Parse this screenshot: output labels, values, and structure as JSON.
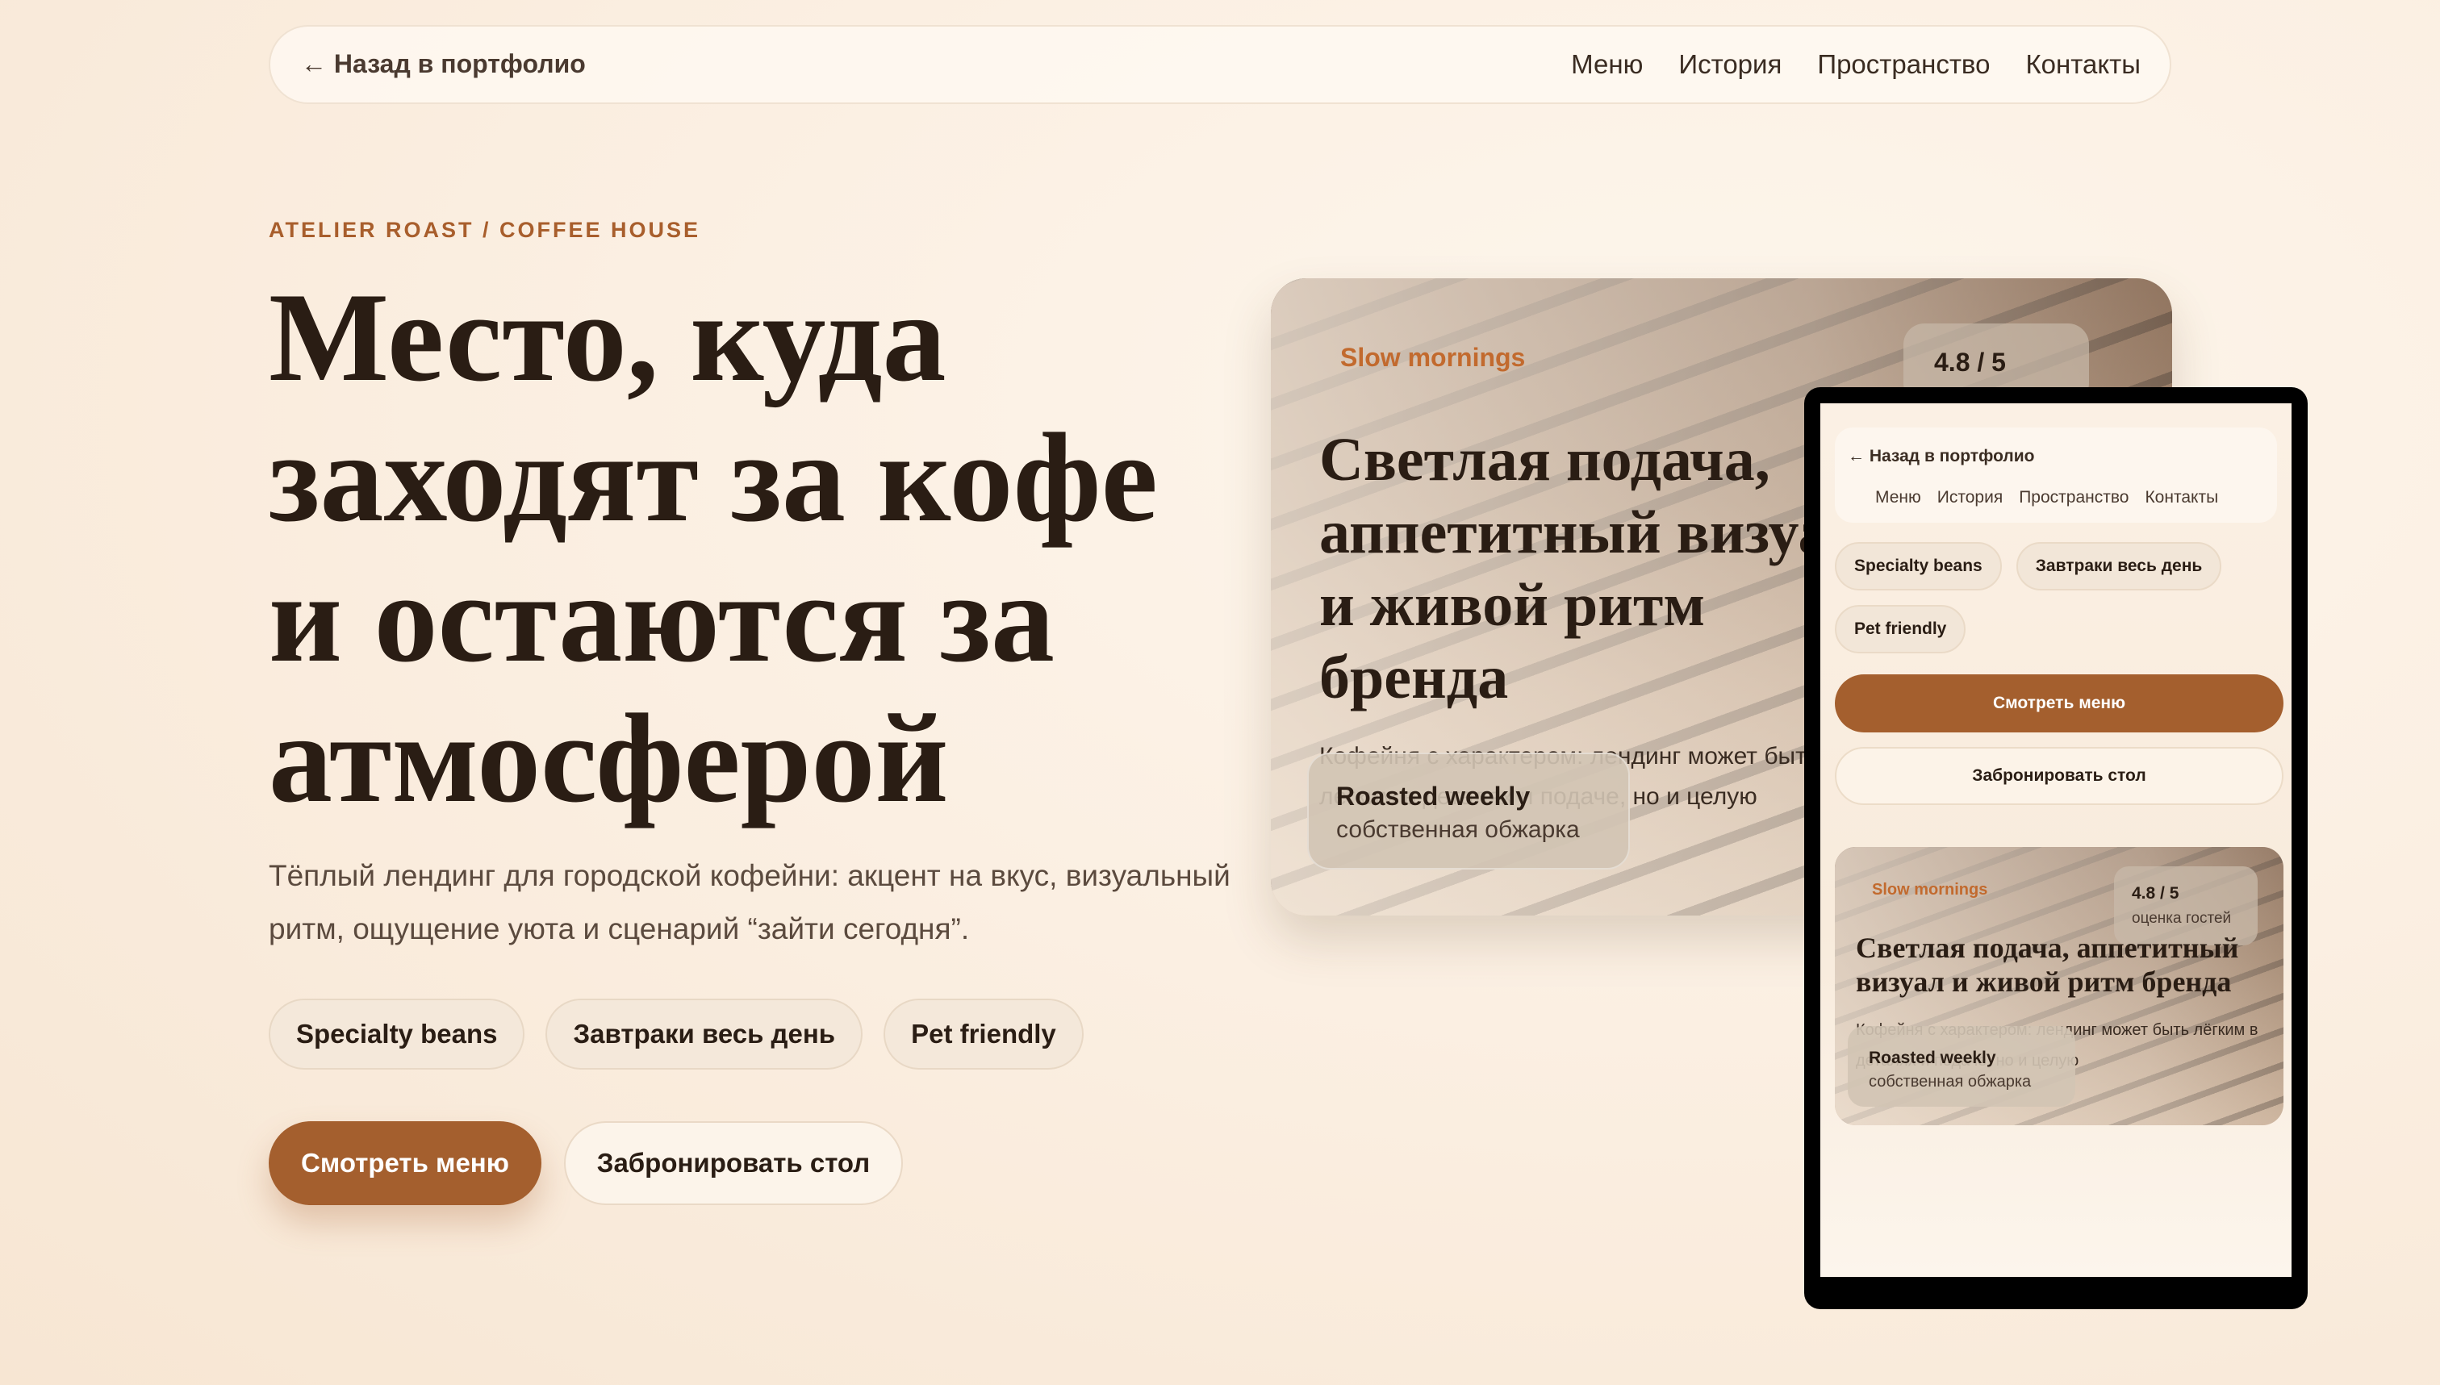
{
  "nav": {
    "back": "← Назад в портфолио",
    "links": [
      "Меню",
      "История",
      "Пространство",
      "Контакты"
    ]
  },
  "hero": {
    "kicker": "ATELIER ROAST / COFFEE HOUSE",
    "title": "Место, куда заходят за кофе и остаются за атмосферой",
    "description": "Тёплый лендинг для городской кофейни: акцент на вкус, визуальный ритм, ощущение уюта и сценарий “зайти сегодня”.",
    "tags": [
      "Specialty beans",
      "Завтраки весь день",
      "Pet friendly"
    ],
    "primary_button": "Смотреть меню",
    "secondary_button": "Забронировать стол"
  },
  "desktop_preview": {
    "eyebrow": "Slow mornings",
    "rating": "4.8 / 5",
    "title": "Светлая подача, аппетитный визуал и живой ритм бренда",
    "text": "Кофейня с характером: лендинг может быть лёгким в деталях и подаче, но и целую",
    "badge_title": "Roasted weekly",
    "badge_subtitle": "собственная обжарка"
  },
  "mobile_preview": {
    "back": "← Назад в портфолио",
    "links": [
      "Меню",
      "История",
      "Пространство",
      "Контакты"
    ],
    "tags": [
      "Specialty beans",
      "Завтраки весь день",
      "Pet friendly"
    ],
    "primary_button": "Смотреть меню",
    "secondary_button": "Забронировать стол",
    "card": {
      "eyebrow": "Slow mornings",
      "rating": "4.8 / 5",
      "rating_caption": "оценка гостей",
      "title": "Светлая подача, аппетитный визуал и живой ритм бренда",
      "text": "Кофейня с характером: лендинг может быть лёгким в деталях и подаче, но и целую",
      "badge_title": "Roasted weekly",
      "badge_subtitle": "собственная обжарка"
    }
  },
  "colors": {
    "accent": "#a45f2e",
    "kicker": "#a85e2c",
    "text": "#2a1d14",
    "background": "#fbefe2"
  }
}
